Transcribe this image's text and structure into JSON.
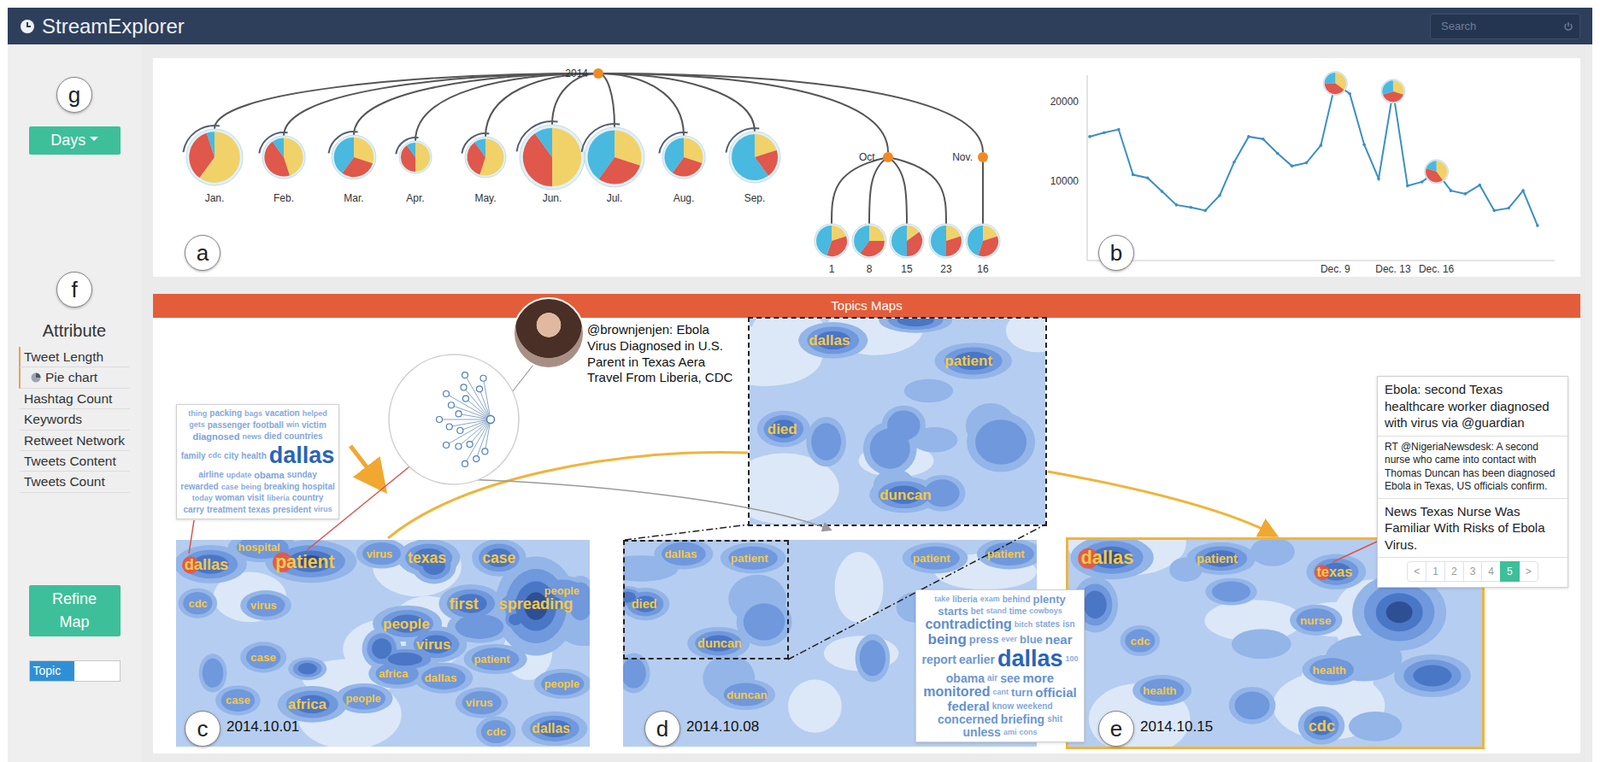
{
  "app": {
    "title": "StreamExplorer"
  },
  "search": {
    "placeholder": "Search"
  },
  "pie_colors": [
    "#f2cf5b",
    "#e04a3c",
    "#3cb4dc"
  ],
  "sidebar": {
    "granularity": {
      "badge": "g",
      "value": "Days"
    },
    "attribute": {
      "badge": "f",
      "title": "Attribute",
      "items": [
        {
          "label": "Tweet Length",
          "kind": "item",
          "selected": true
        },
        {
          "label": "Pie chart",
          "kind": "sub",
          "selected": true
        },
        {
          "label": "Hashtag Count",
          "kind": "item",
          "selected": false
        },
        {
          "label": "Keywords",
          "kind": "item",
          "selected": false
        },
        {
          "label": "Retweet Network",
          "kind": "item",
          "selected": false
        },
        {
          "label": "Tweets Content",
          "kind": "item",
          "selected": false
        },
        {
          "label": "Tweets Count",
          "kind": "item",
          "selected": false
        }
      ]
    },
    "refine": {
      "label": "Refine Map"
    },
    "toggle": {
      "label": "Topic",
      "level": 0.5
    }
  },
  "timeline": {
    "badge": "a",
    "root": "2014",
    "months": [
      {
        "label": "Jan.",
        "level": 0.87,
        "mix": [
          0.6,
          0.35,
          0.05
        ]
      },
      {
        "label": "Feb.",
        "level": 0.66,
        "mix": [
          0.45,
          0.45,
          0.1
        ]
      },
      {
        "label": "Mar.",
        "level": 0.68,
        "mix": [
          0.3,
          0.3,
          0.4
        ]
      },
      {
        "label": "Apr.",
        "level": 0.5,
        "mix": [
          0.5,
          0.4,
          0.1
        ]
      },
      {
        "label": "May.",
        "level": 0.63,
        "mix": [
          0.55,
          0.35,
          0.1
        ]
      },
      {
        "label": "Jun.",
        "level": 1.0,
        "mix": [
          0.5,
          0.4,
          0.1
        ]
      },
      {
        "label": "Jul.",
        "level": 0.92,
        "mix": [
          0.3,
          0.3,
          0.4
        ]
      },
      {
        "label": "Aug.",
        "level": 0.66,
        "mix": [
          0.3,
          0.3,
          0.4
        ]
      },
      {
        "label": "Sep.",
        "level": 0.79,
        "mix": [
          0.2,
          0.2,
          0.6
        ]
      }
    ],
    "groups": [
      {
        "label": "Oct.",
        "children": [
          {
            "label": "1",
            "mix": [
              0.2,
              0.35,
              0.45
            ]
          },
          {
            "label": "8",
            "mix": [
              0.25,
              0.35,
              0.4
            ]
          },
          {
            "label": "15",
            "mix": [
              0.15,
              0.35,
              0.5
            ]
          },
          {
            "label": "23",
            "mix": [
              0.2,
              0.3,
              0.5
            ]
          }
        ]
      },
      {
        "label": "Nov.",
        "children": [
          {
            "label": "16",
            "mix": [
              0.2,
              0.35,
              0.45
            ]
          }
        ]
      }
    ]
  },
  "volume_chart": {
    "badge": "b",
    "y_ticks": [
      {
        "text": "20000",
        "value": 20000
      },
      {
        "text": "10000",
        "value": 10000
      }
    ],
    "values": [
      15600,
      16100,
      16500,
      10800,
      10400,
      8700,
      7000,
      6700,
      6300,
      8200,
      12400,
      15600,
      15300,
      13500,
      11900,
      12300,
      14500,
      22300,
      21000,
      14600,
      10300,
      21300,
      9400,
      9900,
      11200,
      8800,
      8400,
      9500,
      6300,
      6600,
      8800,
      4400
    ],
    "x_labels": [
      {
        "text": "Dec. 9",
        "index": 17
      },
      {
        "text": "Dec. 13",
        "index": 21
      },
      {
        "text": "Dec. 16",
        "index": 24
      }
    ],
    "glyphs": [
      {
        "index": 17,
        "mix": [
          0.35,
          0.4,
          0.25
        ]
      },
      {
        "index": 21,
        "mix": [
          0.3,
          0.4,
          0.3
        ]
      },
      {
        "index": 24,
        "mix": [
          0.4,
          0.4,
          0.2
        ]
      }
    ]
  },
  "topics": {
    "title": "Topics Maps",
    "maps": [
      {
        "badge": "c",
        "date": "2014.10.01",
        "selected": false,
        "keywords": [
          {
            "text": "dallas",
            "weight": 0.6,
            "marked": true
          },
          {
            "text": "hospital",
            "weight": 0.15,
            "marked": false
          },
          {
            "text": "patient",
            "weight": 0.85,
            "marked": true
          },
          {
            "text": "virus",
            "weight": 0.15,
            "marked": false
          },
          {
            "text": "texas",
            "weight": 0.55,
            "marked": false
          },
          {
            "text": "case",
            "weight": 0.55,
            "marked": false
          },
          {
            "text": "cdc",
            "weight": 0.15,
            "marked": false
          },
          {
            "text": "virus",
            "weight": 0.15,
            "marked": false
          },
          {
            "text": "people",
            "weight": 0.15,
            "marked": false
          },
          {
            "text": "people",
            "weight": 0.5,
            "marked": false
          },
          {
            "text": "first",
            "weight": 0.6,
            "marked": false
          },
          {
            "text": "spreading",
            "weight": 0.6,
            "marked": false
          },
          {
            "text": "case",
            "weight": 0.2,
            "marked": false
          },
          {
            "text": "virus",
            "weight": 0.5,
            "marked": false
          },
          {
            "text": "patient",
            "weight": 0.15,
            "marked": false
          },
          {
            "text": "africa",
            "weight": 0.15,
            "marked": false
          },
          {
            "text": "dallas",
            "weight": 0.2,
            "marked": false
          },
          {
            "text": "people",
            "weight": 0.15,
            "marked": false
          },
          {
            "text": "africa",
            "weight": 0.5,
            "marked": false
          },
          {
            "text": "people",
            "weight": 0.15,
            "marked": false
          },
          {
            "text": "case",
            "weight": 0.15,
            "marked": false
          },
          {
            "text": "virus",
            "weight": 0.2,
            "marked": false
          },
          {
            "text": "cdc",
            "weight": 0.2,
            "marked": false
          },
          {
            "text": "dallas",
            "weight": 0.4,
            "marked": false
          }
        ]
      },
      {
        "badge": "d",
        "date": "2014.10.08",
        "selected": false,
        "keywords": [
          {
            "text": "dallas",
            "weight": 0.2,
            "marked": false
          },
          {
            "text": "patient",
            "weight": 0.2,
            "marked": false
          },
          {
            "text": "died",
            "weight": 0.3,
            "marked": false
          },
          {
            "text": "duncan",
            "weight": 0.3,
            "marked": false
          },
          {
            "text": "duncan",
            "weight": 0.2,
            "marked": false
          },
          {
            "text": "patient",
            "weight": 0.2,
            "marked": false
          },
          {
            "text": "patient",
            "weight": 0.2,
            "marked": false
          }
        ]
      },
      {
        "badge": "e",
        "date": "2014.10.15",
        "selected": true,
        "keywords": [
          {
            "text": "dallas",
            "weight": 0.9,
            "marked": true
          },
          {
            "text": "patient",
            "weight": 0.3,
            "marked": false
          },
          {
            "text": "texas",
            "weight": 0.45,
            "marked": true
          },
          {
            "text": "nurse",
            "weight": 0.2,
            "marked": false
          },
          {
            "text": "cdc",
            "weight": 0.2,
            "marked": false
          },
          {
            "text": "health",
            "weight": 0.2,
            "marked": false
          },
          {
            "text": "health",
            "weight": 0.2,
            "marked": false
          },
          {
            "text": "cdc",
            "weight": 0.6,
            "marked": false
          }
        ]
      }
    ],
    "zoom": {
      "keywords": [
        {
          "text": "dallas",
          "weight": 0.5
        },
        {
          "text": "patient",
          "weight": 0.5
        },
        {
          "text": "died",
          "weight": 0.5
        },
        {
          "text": "duncan",
          "weight": 0.5
        }
      ]
    },
    "left_cloud": {
      "words": [
        {
          "text": "thing",
          "weight": 0.1
        },
        {
          "text": "packing",
          "weight": 0.15
        },
        {
          "text": "bags",
          "weight": 0.1
        },
        {
          "text": "vacation",
          "weight": 0.15
        },
        {
          "text": "helped",
          "weight": 0.1
        },
        {
          "text": "gets",
          "weight": 0.1
        },
        {
          "text": "passenger",
          "weight": 0.15
        },
        {
          "text": "football",
          "weight": 0.15
        },
        {
          "text": "win",
          "weight": 0.1
        },
        {
          "text": "victim",
          "weight": 0.15
        },
        {
          "text": "diagnosed",
          "weight": 0.2
        },
        {
          "text": "news",
          "weight": 0.1
        },
        {
          "text": "died",
          "weight": 0.15
        },
        {
          "text": "countries",
          "weight": 0.15
        },
        {
          "text": "family",
          "weight": 0.15
        },
        {
          "text": "cdc",
          "weight": 0.1
        },
        {
          "text": "city",
          "weight": 0.15
        },
        {
          "text": "health",
          "weight": 0.15
        },
        {
          "text": "dallas",
          "weight": 1.0
        },
        {
          "text": "airline",
          "weight": 0.15
        },
        {
          "text": "update",
          "weight": 0.1
        },
        {
          "text": "obama",
          "weight": 0.2
        },
        {
          "text": "sunday",
          "weight": 0.15
        },
        {
          "text": "rewarded",
          "weight": 0.15
        },
        {
          "text": "case",
          "weight": 0.1
        },
        {
          "text": "being",
          "weight": 0.1
        },
        {
          "text": "breaking",
          "weight": 0.15
        },
        {
          "text": "hospital",
          "weight": 0.15
        },
        {
          "text": "today",
          "weight": 0.1
        },
        {
          "text": "woman",
          "weight": 0.15
        },
        {
          "text": "visit",
          "weight": 0.15
        },
        {
          "text": "liberia",
          "weight": 0.1
        },
        {
          "text": "country",
          "weight": 0.15
        },
        {
          "text": "carry",
          "weight": 0.15
        },
        {
          "text": "treatment",
          "weight": 0.15
        },
        {
          "text": "texas",
          "weight": 0.15
        },
        {
          "text": "president",
          "weight": 0.15
        },
        {
          "text": "virus",
          "weight": 0.1
        }
      ]
    },
    "right_cloud": {
      "words": [
        {
          "text": "take",
          "weight": 0.1
        },
        {
          "text": "liberia",
          "weight": 0.15
        },
        {
          "text": "exam",
          "weight": 0.1
        },
        {
          "text": "behind",
          "weight": 0.15
        },
        {
          "text": "plenty",
          "weight": 0.3
        },
        {
          "text": "starts",
          "weight": 0.3
        },
        {
          "text": "bet",
          "weight": 0.15
        },
        {
          "text": "stand",
          "weight": 0.1
        },
        {
          "text": "time",
          "weight": 0.15
        },
        {
          "text": "cowboys",
          "weight": 0.1
        },
        {
          "text": "contradicting",
          "weight": 0.45
        },
        {
          "text": "bitch",
          "weight": 0.1
        },
        {
          "text": "states",
          "weight": 0.15
        },
        {
          "text": "isn",
          "weight": 0.15
        },
        {
          "text": "being",
          "weight": 0.5
        },
        {
          "text": "press",
          "weight": 0.3
        },
        {
          "text": "ever",
          "weight": 0.1
        },
        {
          "text": "blue",
          "weight": 0.3
        },
        {
          "text": "near",
          "weight": 0.4
        },
        {
          "text": "report",
          "weight": 0.35
        },
        {
          "text": "earlier",
          "weight": 0.35
        },
        {
          "text": "dallas",
          "weight": 1.0
        },
        {
          "text": "100",
          "weight": 0.1
        },
        {
          "text": "obama",
          "weight": 0.35
        },
        {
          "text": "air",
          "weight": 0.15
        },
        {
          "text": "see",
          "weight": 0.35
        },
        {
          "text": "more",
          "weight": 0.4
        },
        {
          "text": "monitored",
          "weight": 0.45
        },
        {
          "text": "cant",
          "weight": 0.1
        },
        {
          "text": "turn",
          "weight": 0.3
        },
        {
          "text": "official",
          "weight": 0.4
        },
        {
          "text": "federal",
          "weight": 0.4
        },
        {
          "text": "know",
          "weight": 0.15
        },
        {
          "text": "weekend",
          "weight": 0.15
        },
        {
          "text": "concerned",
          "weight": 0.35
        },
        {
          "text": "briefing",
          "weight": 0.35
        },
        {
          "text": "shit",
          "weight": 0.15
        },
        {
          "text": "unless",
          "weight": 0.35
        },
        {
          "text": "ami",
          "weight": 0.1
        },
        {
          "text": "cons",
          "weight": 0.1
        }
      ]
    },
    "tweet": {
      "text": "@brownjenjen: Ebola Virus Diagnosed in U.S. Parent in Texas Aera Travel From Liberia, CDC"
    },
    "network": {
      "nodes": 17
    },
    "tweet_list": {
      "items": [
        {
          "text": "Ebola: second Texas healthcare worker diagnosed with virus via @guardian",
          "kind": "headline"
        },
        {
          "text": "RT @NigeriaNewsdesk: A second nurse who came into contact with Thomas Duncan has been diagnosed Ebola in Texas, US officials confirm.",
          "kind": "retweet"
        },
        {
          "text": "News Texas Nurse Was Familiar With Risks of Ebola Virus.",
          "kind": "headline"
        }
      ],
      "pages": [
        {
          "label": "<",
          "selected": false
        },
        {
          "label": "1",
          "selected": false
        },
        {
          "label": "2",
          "selected": false
        },
        {
          "label": "3",
          "selected": false
        },
        {
          "label": "4",
          "selected": false
        },
        {
          "label": "5",
          "selected": true
        },
        {
          "label": ">",
          "selected": false
        }
      ]
    }
  }
}
